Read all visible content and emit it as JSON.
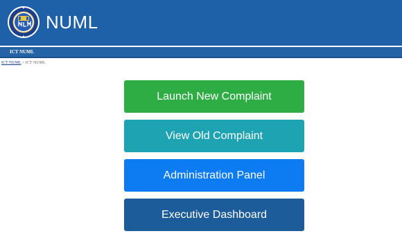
{
  "header": {
    "title": "NUML",
    "logo_icon": "numl-university-seal-icon"
  },
  "subbar": {
    "label": "ICT NUML"
  },
  "breadcrumb": {
    "link": "ICT NUML",
    "separator": ">",
    "current": "ICT NUML"
  },
  "menu": [
    {
      "label": "Launch New Complaint",
      "color": "#2fad45"
    },
    {
      "label": "View Old Complaint",
      "color": "#1ea3b3"
    },
    {
      "label": "Administration Panel",
      "color": "#0d7cf2"
    },
    {
      "label": "Executive Dashboard",
      "color": "#1d5c9b"
    }
  ],
  "colors": {
    "header_bg": "#1e61a8",
    "subbar_bg": "#2363a6"
  }
}
